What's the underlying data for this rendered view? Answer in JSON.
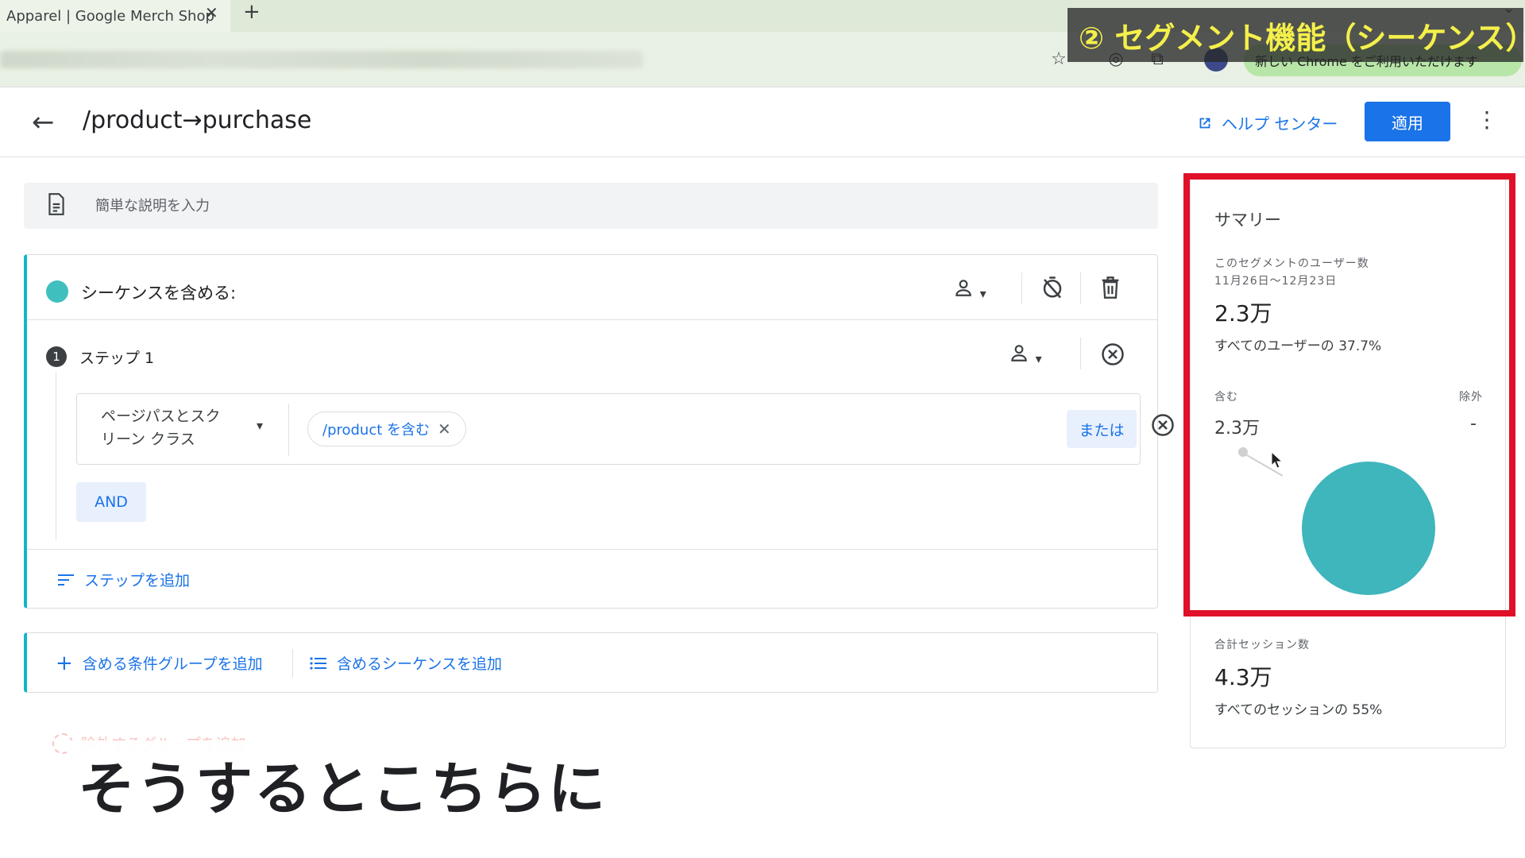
{
  "browser": {
    "tab_title": "Apparel | Google Merch Shop",
    "tab_close": "✕",
    "new_tab": "+",
    "update_text": "新しい Chrome をご利用いただけます"
  },
  "overlay": {
    "title": "② セグメント機能（シーケンス）"
  },
  "header": {
    "back": "←",
    "title": "/product→purchase",
    "help_label": "ヘルプ センター",
    "apply_label": "適用",
    "more": "⋮"
  },
  "description": {
    "placeholder": "簡単な説明を入力"
  },
  "sequence": {
    "label": "シーケンスを含める:",
    "step": {
      "number": "1",
      "label": "ステップ 1",
      "dimension_line1": "ページパスとスク",
      "dimension_line2": "リーン クラス",
      "chip_label": "/product を含む",
      "or_label": "または",
      "and_label": "AND"
    },
    "add_step_label": "ステップを追加"
  },
  "groups": {
    "add_condition_group": "含める条件グループを追加",
    "add_sequence": "含めるシーケンスを追加",
    "exclude_group": "除外するグループを追加"
  },
  "caption": "そうするとこちらに",
  "summary": {
    "title": "サマリー",
    "users_label": "このセグメントのユーザー数",
    "date_range": "11月26日～12月23日",
    "users_value": "2.3万",
    "users_share": "すべてのユーザーの 37.7%",
    "include_label": "含む",
    "exclude_label": "除外",
    "include_value": "2.3万",
    "exclude_value": "-",
    "sessions_label": "合計セッション数",
    "sessions_value": "4.3万",
    "sessions_share": "すべてのセッションの 55%"
  },
  "colors": {
    "accent": "#1a73e8",
    "teal": "#3fb5bc",
    "highlight_red": "#e0102a",
    "overlay_text": "#f4f04a"
  },
  "icons": {
    "document": "document-icon",
    "person": "person-icon",
    "timer_off": "timer-off-icon",
    "delete": "trash-icon",
    "remove": "remove-circle-icon",
    "add": "plus-icon",
    "list": "list-icon",
    "external": "open-external-icon"
  }
}
